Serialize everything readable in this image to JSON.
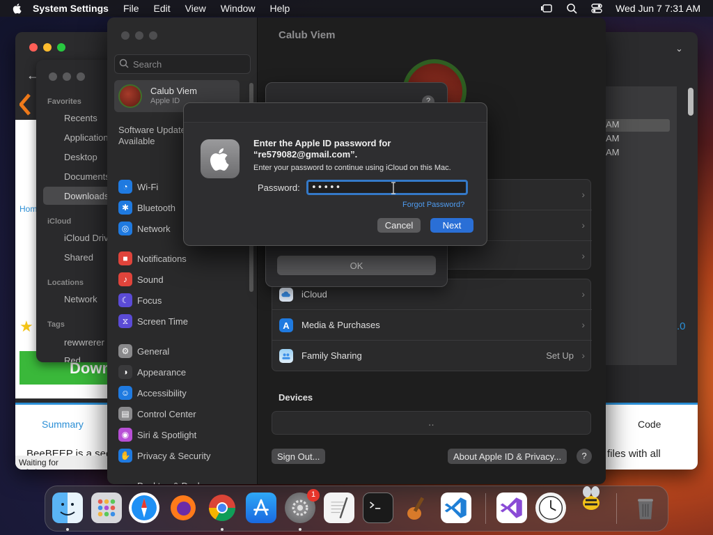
{
  "menubar": {
    "app_name": "System Settings",
    "menus": [
      "File",
      "Edit",
      "View",
      "Window",
      "Help"
    ],
    "clock": "Wed Jun 7  7:31 AM"
  },
  "browser": {
    "summary_tab": "Summary",
    "code_tab": "Code",
    "description_fragment": "BeeBEEP is a sec",
    "right_fragment": "files with all",
    "status_text": "Waiting for a.fsdn.com...",
    "download_label": "Down",
    "home_fragment": "Hom",
    "times": [
      "AM",
      "AM",
      "AM"
    ],
    "version_fragment": ".0"
  },
  "finder": {
    "favorites_label": "Favorites",
    "favorites": [
      "Recents",
      "Applications",
      "Desktop",
      "Documents",
      "Downloads"
    ],
    "icloud_label": "iCloud",
    "icloud_items": [
      "iCloud Drive",
      "Shared"
    ],
    "locations_label": "Locations",
    "locations_items": [
      "Network"
    ],
    "tags_label": "Tags",
    "tags_items": [
      "rewwrerer",
      "Red"
    ]
  },
  "settings": {
    "search_placeholder": "Search",
    "account_name": "Calub Viem",
    "account_sub": "Apple ID",
    "update_line1": "Software Update",
    "update_line2": "Available",
    "sidebar_items": [
      {
        "label": "Wi-Fi",
        "color": "#1f7ae0"
      },
      {
        "label": "Bluetooth",
        "color": "#1f7ae0"
      },
      {
        "label": "Network",
        "color": "#1f7ae0"
      },
      {
        "label": "Notifications",
        "color": "#e0443b"
      },
      {
        "label": "Sound",
        "color": "#e0443b"
      },
      {
        "label": "Focus",
        "color": "#5b4bd6"
      },
      {
        "label": "Screen Time",
        "color": "#5b4bd6"
      },
      {
        "label": "General",
        "color": "#8a8a8c"
      },
      {
        "label": "Appearance",
        "color": "#3a3a3c"
      },
      {
        "label": "Accessibility",
        "color": "#1f7ae0"
      },
      {
        "label": "Control Center",
        "color": "#8a8a8c"
      },
      {
        "label": "Siri & Spotlight",
        "color": "#b84fd6"
      },
      {
        "label": "Privacy & Security",
        "color": "#1f7ae0"
      },
      {
        "label": "Desktop & Dock",
        "color": "#2a2a2c"
      }
    ],
    "window_title": "Calub Viem",
    "services": [
      {
        "label": "iCloud",
        "value": ""
      },
      {
        "label": "Media & Purchases",
        "value": ""
      },
      {
        "label": "Family Sharing",
        "value": "Set Up"
      }
    ],
    "devices_title": "Devices",
    "sign_out": "Sign Out...",
    "about": "About Apple ID & Privacy...",
    "help": "?"
  },
  "ok_dialog": {
    "ok_label": "OK",
    "help": "?"
  },
  "password_dialog": {
    "title_line1": "Enter the Apple ID password for",
    "title_line2": "“re579082@gmail.com”.",
    "message": "Enter your password to continue using iCloud on this Mac.",
    "password_label": "Password:",
    "password_value": "•••••",
    "forgot": "Forgot Password?",
    "cancel": "Cancel",
    "next": "Next"
  },
  "dock": {
    "settings_badge": "1"
  }
}
